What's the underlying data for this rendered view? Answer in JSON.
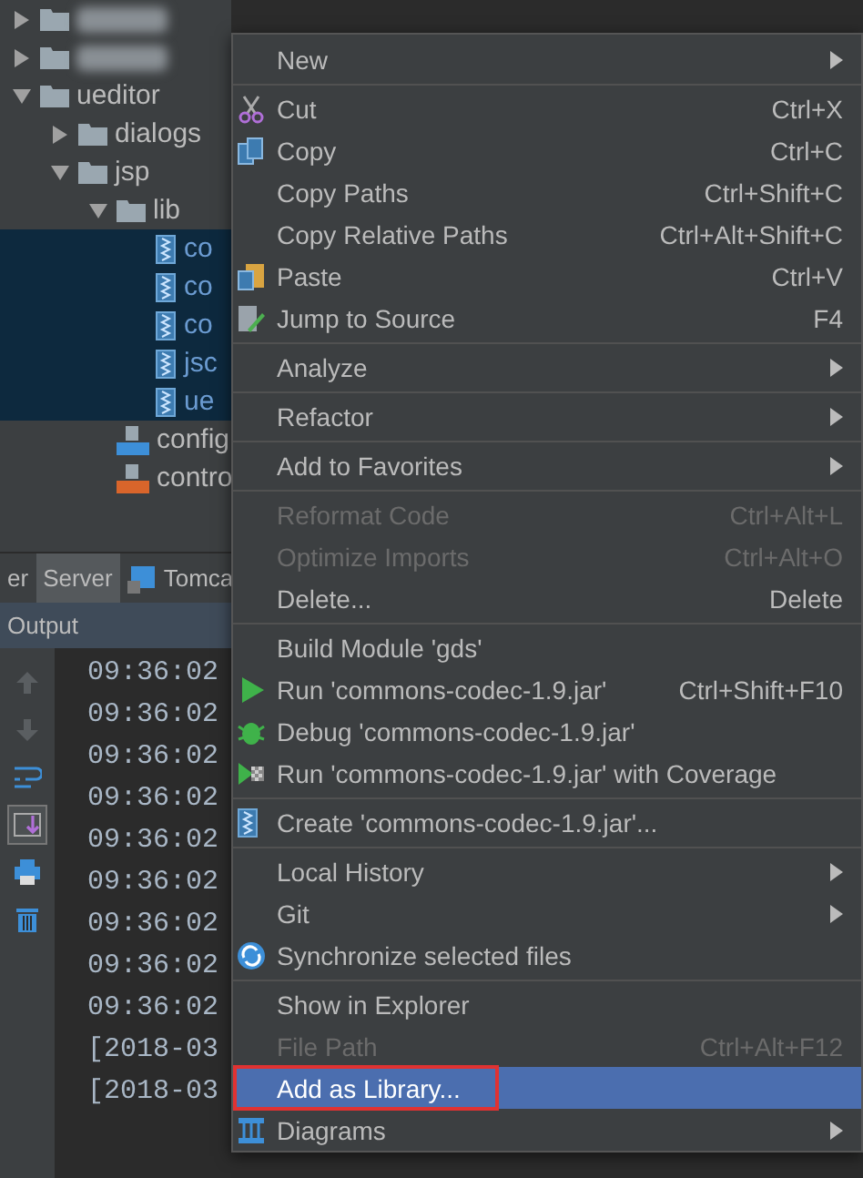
{
  "project_tree": [
    {
      "kind": "folder",
      "expanded": false,
      "selected": false
    },
    {
      "kind": "folder",
      "expanded": false,
      "selected": false
    },
    {
      "kind": "folder",
      "label": "ueditor",
      "expanded": true,
      "selected": false,
      "children": [
        {
          "kind": "folder",
          "label": "dialogs",
          "expanded": false,
          "selected": false
        },
        {
          "kind": "folder",
          "label": "jsp",
          "expanded": true,
          "selected": false,
          "children": [
            {
              "kind": "folder",
              "label": "lib",
              "expanded": true,
              "selected": false,
              "children": [
                {
                  "kind": "jar",
                  "label": "co",
                  "selected": true
                },
                {
                  "kind": "jar",
                  "label": "co",
                  "selected": true
                },
                {
                  "kind": "jar",
                  "label": "co",
                  "selected": true
                },
                {
                  "kind": "jar",
                  "label": "jsc",
                  "selected": true
                },
                {
                  "kind": "jar",
                  "label": "ue",
                  "selected": true
                }
              ]
            },
            {
              "kind": "json",
              "label": "config",
              "selected": false
            },
            {
              "kind": "jsp",
              "label": "contro",
              "selected": false
            }
          ]
        }
      ]
    }
  ],
  "tool_tabs": [
    {
      "label": "er",
      "selected": false
    },
    {
      "label": "Server",
      "selected": true
    },
    {
      "label": "Tomca",
      "selected": false,
      "kind": "server"
    }
  ],
  "output": {
    "title": "Output",
    "toolbar": [
      {
        "kind": "up",
        "disabled": true,
        "selected": false
      },
      {
        "kind": "down",
        "disabled": true,
        "selected": false
      },
      {
        "kind": "wrap",
        "disabled": false,
        "selected": false
      },
      {
        "kind": "scroll",
        "disabled": false,
        "selected": true
      },
      {
        "kind": "print",
        "disabled": false,
        "selected": false
      },
      {
        "kind": "trash",
        "disabled": false,
        "selected": false
      }
    ],
    "lines": [
      "09:36:02",
      "09:36:02",
      "09:36:02",
      "09:36:02",
      "09:36:02",
      "09:36:02",
      "09:36:02",
      "09:36:02",
      "09:36:02",
      "[2018-03",
      "[2018-03"
    ]
  },
  "context_menu": {
    "groups": [
      {
        "items": [
          {
            "label": "New",
            "submenu": true,
            "disabled": false,
            "selected": false,
            "outlined": false
          }
        ]
      },
      {
        "items": [
          {
            "label": "Cut",
            "shortcut": "Ctrl+X",
            "kind": "cut",
            "submenu": false,
            "disabled": false,
            "selected": false,
            "outlined": false
          },
          {
            "label": "Copy",
            "shortcut": "Ctrl+C",
            "kind": "copy",
            "submenu": false,
            "disabled": false,
            "selected": false,
            "outlined": false
          },
          {
            "label": "Copy Paths",
            "shortcut": "Ctrl+Shift+C",
            "submenu": false,
            "disabled": false,
            "selected": false,
            "outlined": false
          },
          {
            "label": "Copy Relative Paths",
            "shortcut": "Ctrl+Alt+Shift+C",
            "submenu": false,
            "disabled": false,
            "selected": false,
            "outlined": false
          },
          {
            "label": "Paste",
            "shortcut": "Ctrl+V",
            "kind": "paste",
            "submenu": false,
            "disabled": false,
            "selected": false,
            "outlined": false
          },
          {
            "label": "Jump to Source",
            "shortcut": "F4",
            "kind": "jump",
            "submenu": false,
            "disabled": false,
            "selected": false,
            "outlined": false
          }
        ]
      },
      {
        "items": [
          {
            "label": "Analyze",
            "submenu": true,
            "disabled": false,
            "selected": false,
            "outlined": false
          }
        ]
      },
      {
        "items": [
          {
            "label": "Refactor",
            "submenu": true,
            "disabled": false,
            "selected": false,
            "outlined": false
          }
        ]
      },
      {
        "items": [
          {
            "label": "Add to Favorites",
            "submenu": true,
            "disabled": false,
            "selected": false,
            "outlined": false
          }
        ]
      },
      {
        "items": [
          {
            "label": "Reformat Code",
            "shortcut": "Ctrl+Alt+L",
            "submenu": false,
            "disabled": true,
            "selected": false,
            "outlined": false
          },
          {
            "label": "Optimize Imports",
            "shortcut": "Ctrl+Alt+O",
            "submenu": false,
            "disabled": true,
            "selected": false,
            "outlined": false
          },
          {
            "label": "Delete...",
            "shortcut": "Delete",
            "submenu": false,
            "disabled": false,
            "selected": false,
            "outlined": false
          }
        ]
      },
      {
        "items": [
          {
            "label": "Build Module 'gds'",
            "submenu": false,
            "disabled": false,
            "selected": false,
            "outlined": false
          },
          {
            "label": "Run 'commons-codec-1.9.jar'",
            "shortcut": "Ctrl+Shift+F10",
            "kind": "run",
            "submenu": false,
            "disabled": false,
            "selected": false,
            "outlined": false
          },
          {
            "label": "Debug 'commons-codec-1.9.jar'",
            "kind": "debug",
            "submenu": false,
            "disabled": false,
            "selected": false,
            "outlined": false
          },
          {
            "label": "Run 'commons-codec-1.9.jar' with Coverage",
            "kind": "coverage",
            "submenu": false,
            "disabled": false,
            "selected": false,
            "outlined": false
          }
        ]
      },
      {
        "items": [
          {
            "label": "Create 'commons-codec-1.9.jar'...",
            "kind": "jar",
            "submenu": false,
            "disabled": false,
            "selected": false,
            "outlined": false
          }
        ]
      },
      {
        "items": [
          {
            "label": "Local History",
            "submenu": true,
            "disabled": false,
            "selected": false,
            "outlined": false
          },
          {
            "label": "Git",
            "submenu": true,
            "disabled": false,
            "selected": false,
            "outlined": false
          },
          {
            "label": "Synchronize selected files",
            "kind": "sync",
            "submenu": false,
            "disabled": false,
            "selected": false,
            "outlined": false
          }
        ]
      },
      {
        "items": [
          {
            "label": "Show in Explorer",
            "submenu": false,
            "disabled": false,
            "selected": false,
            "outlined": false
          },
          {
            "label": "File Path",
            "shortcut": "Ctrl+Alt+F12",
            "submenu": false,
            "disabled": true,
            "selected": false,
            "outlined": false
          },
          {
            "label": "Add as Library...",
            "submenu": false,
            "disabled": false,
            "selected": true,
            "outlined": true
          },
          {
            "label": "Diagrams",
            "kind": "diagram",
            "submenu": true,
            "disabled": false,
            "selected": false,
            "outlined": false
          }
        ]
      }
    ]
  }
}
